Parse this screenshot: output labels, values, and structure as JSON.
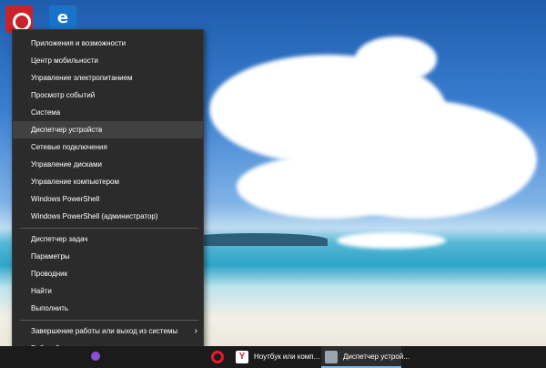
{
  "menu": {
    "items": [
      {
        "label": "Приложения и возможности"
      },
      {
        "label": "Центр мобильности"
      },
      {
        "label": "Управление электропитанием"
      },
      {
        "label": "Просмотр событий"
      },
      {
        "label": "Система"
      },
      {
        "label": "Диспетчер устройств"
      },
      {
        "label": "Сетевые подключения"
      },
      {
        "label": "Управление дисками"
      },
      {
        "label": "Управление компьютером"
      },
      {
        "label": "Windows PowerShell"
      },
      {
        "label": "Windows PowerShell (администратор)"
      },
      {
        "label": "Диспетчер задач"
      },
      {
        "label": "Параметры"
      },
      {
        "label": "Проводник"
      },
      {
        "label": "Найти"
      },
      {
        "label": "Выполнить"
      },
      {
        "label": "Завершение работы или выход из системы"
      },
      {
        "label": "Рабочий стол"
      }
    ],
    "highlighted": "Диспетчер устройств"
  },
  "desktop": {
    "icon_edge_glyph": "e"
  },
  "taskbar": {
    "yandex_window": "Ноутбук или комп...",
    "device_manager_window": "Диспетчер устрой...",
    "yandex_icon_glyph": "Y"
  },
  "icons": {
    "submenu_chevron": "›"
  },
  "colors": {
    "menu_bg": "#2b2b2b",
    "menu_highlight": "#414141",
    "taskbar_bg": "#1b1b1b",
    "accent": "#76b9ed"
  }
}
